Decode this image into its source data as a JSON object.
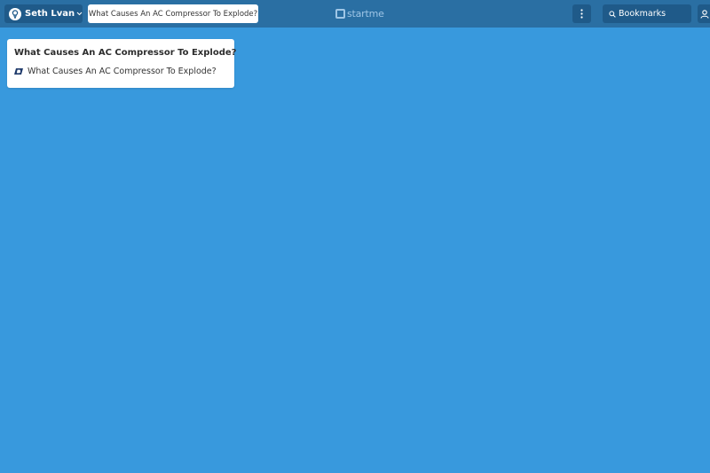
{
  "header": {
    "user_name": "Seth Lvan",
    "page_tab": "What Causes An AC Compressor To Explode?",
    "logo_text": "startme",
    "search_placeholder": "Bookmarks"
  },
  "widget": {
    "title": "What Causes An AC Compressor To Explode?",
    "bookmarks": [
      {
        "label": "What Causes An AC Compressor To Explode?",
        "icon": "favicon-icon"
      }
    ]
  },
  "colors": {
    "background": "#3899dd",
    "topbar": "#2a6fa3",
    "button": "#1f5a89",
    "widget": "#ffffff"
  }
}
